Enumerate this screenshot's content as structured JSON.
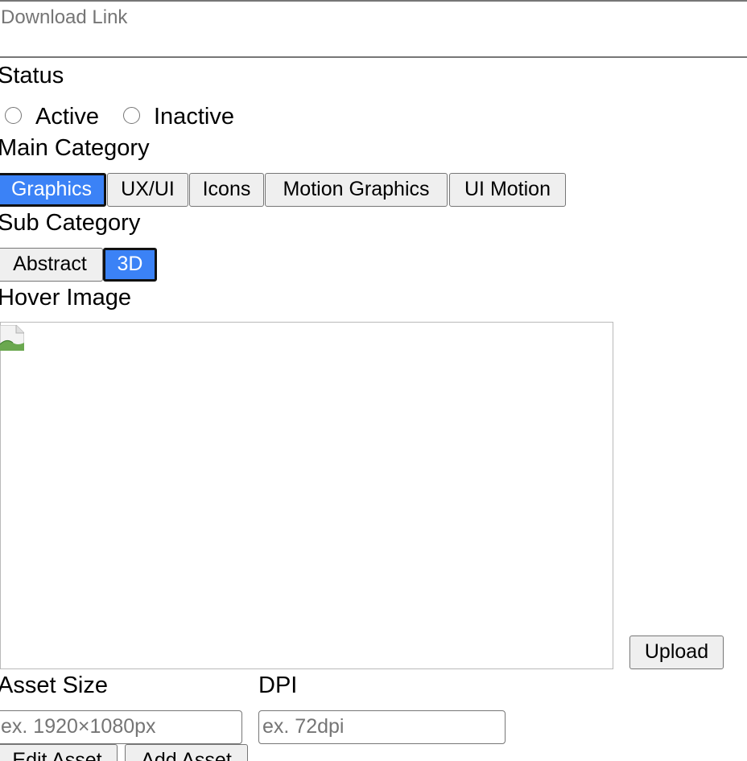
{
  "download_link": {
    "placeholder": "Download Link"
  },
  "status": {
    "label": "Status",
    "options": [
      "Active",
      "Inactive"
    ]
  },
  "main_category": {
    "label": "Main Category",
    "options": [
      "Graphics",
      "UX/UI",
      "Icons",
      "Motion Graphics",
      "UI Motion"
    ],
    "selected": "Graphics"
  },
  "sub_category": {
    "label": "Sub Category",
    "options": [
      "Abstract",
      "3D"
    ],
    "selected": "3D"
  },
  "hover_image": {
    "label": "Hover Image",
    "upload_label": "Upload"
  },
  "asset_size": {
    "label": "Asset Size",
    "placeholder": "ex. 1920×1080px"
  },
  "dpi": {
    "label": "DPI",
    "placeholder": "ex. 72dpi"
  },
  "actions": {
    "edit_label": "Edit Asset",
    "add_label": "Add Asset"
  },
  "colors": {
    "selected_bg": "#3b82f6",
    "button_bg": "#efefef",
    "border": "#767676"
  }
}
